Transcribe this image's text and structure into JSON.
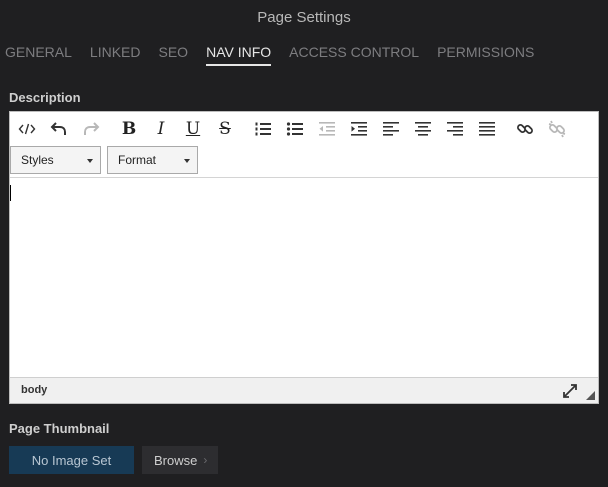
{
  "header": {
    "title": "Page Settings"
  },
  "tabs": [
    {
      "label": "GENERAL",
      "active": false
    },
    {
      "label": "LINKED",
      "active": false
    },
    {
      "label": "SEO",
      "active": false
    },
    {
      "label": "NAV INFO",
      "active": true
    },
    {
      "label": "ACCESS CONTROL",
      "active": false
    },
    {
      "label": "PERMISSIONS",
      "active": false
    }
  ],
  "description": {
    "label": "Description",
    "toolbar": {
      "bold": "B",
      "italic": "I",
      "underline": "U",
      "strike": "S",
      "styles_label": "Styles",
      "format_label": "Format"
    },
    "statusbar": {
      "path": "body"
    }
  },
  "thumbnail": {
    "label": "Page Thumbnail",
    "value": "No Image Set",
    "browse_label": "Browse",
    "browse_chevron": "›"
  }
}
